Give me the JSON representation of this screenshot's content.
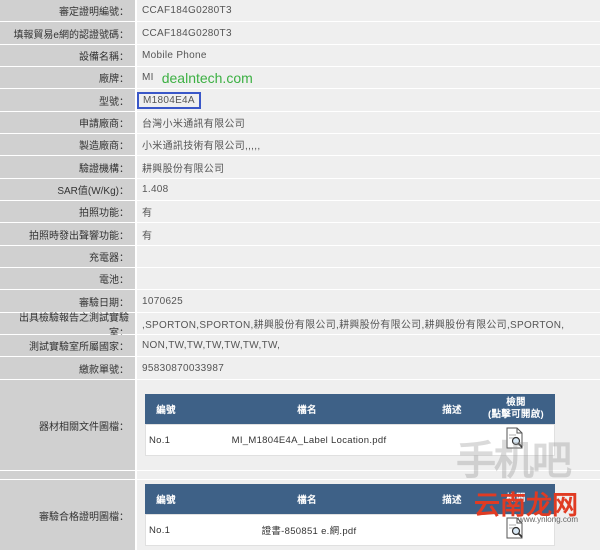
{
  "rows": [
    {
      "label": "審定證明編號：",
      "value": "CCAF184G0280T3"
    },
    {
      "label": "填報貿易e網的認證號碼：",
      "value": "CCAF184G0280T3"
    },
    {
      "label": "設備名稱：",
      "value": "Mobile Phone"
    },
    {
      "label": "廠牌：",
      "value": "MI",
      "watermark": "dealntech.com"
    },
    {
      "label": "型號：",
      "value": "M1804E4A"
    },
    {
      "label": "申請廠商：",
      "value": "台灣小米通訊有限公司"
    },
    {
      "label": "製造廠商：",
      "value": "小米通訊技術有限公司,,,,,"
    },
    {
      "label": "驗證機構：",
      "value": "耕興股份有限公司"
    },
    {
      "label": "SAR值(W/Kg)：",
      "value": "1.408"
    },
    {
      "label": "拍照功能：",
      "value": "有"
    },
    {
      "label": "拍照時發出聲響功能：",
      "value": "有"
    },
    {
      "label": "充電器：",
      "value": ""
    },
    {
      "label": "電池：",
      "value": ""
    },
    {
      "label": "審驗日期：",
      "value": "1070625"
    },
    {
      "label": "出具檢驗報告之測試實驗室：",
      "value": ",SPORTON,SPORTON,耕興股份有限公司,耕興股份有限公司,耕興股份有限公司,SPORTON,"
    },
    {
      "label": "測試實驗室所屬國家：",
      "value": "NON,TW,TW,TW,TW,TW,TW,"
    },
    {
      "label": "繳款單號：",
      "value": "95830870033987"
    }
  ],
  "equipment_docs": {
    "label": "器材相關文件圖檔：",
    "headers": [
      "編號",
      "檔名",
      "描述",
      "檢閱",
      "(點擊可開啟)"
    ],
    "rows": [
      {
        "no": "No.1",
        "file": "MI_M1804E4A_Label Location.pdf",
        "desc": ""
      }
    ]
  },
  "approval_docs": {
    "label": "審驗合格證明圖檔：",
    "headers": [
      "編號",
      "檔名",
      "描述",
      "檢閱"
    ],
    "rows": [
      {
        "no": "No.1",
        "file": "證書-850851 e.網.pdf",
        "desc": ""
      }
    ]
  },
  "branding": {
    "logo_text": "云南龙网",
    "logo_sub": "www.ynlong.com",
    "ghost_text": "手机吧"
  },
  "colors": {
    "label_bg": "#d0d0d0",
    "value_bg": "#efefef",
    "table_header_bg": "#3e6187",
    "highlight_border": "#3a57c8",
    "watermark_green": "#3cb043",
    "logo_red": "#e03b23"
  }
}
